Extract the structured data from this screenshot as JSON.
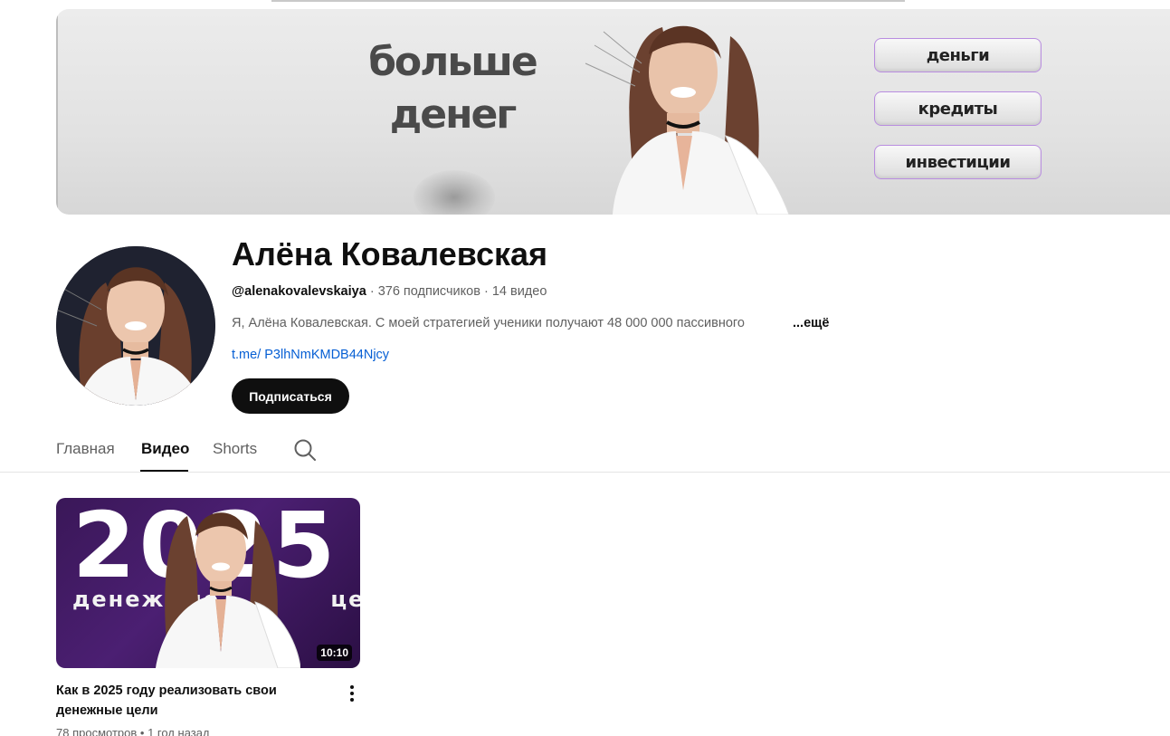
{
  "banner": {
    "headline_line1": "больше",
    "headline_line2": "денег",
    "pills": [
      "деньги",
      "кредиты",
      "инвестиции"
    ]
  },
  "channel": {
    "name": "Алёна Ковалевская",
    "handle": "@alenakovalevskaiya",
    "subscribers": "376 подписчиков",
    "video_count": "14 видео",
    "separator": "·",
    "description": "Я, Алёна Ковалевская. С моей стратегией ученики получают 48 000 000 пассивного",
    "more_label": "...ещё",
    "link": "t.me/ P3lhNmKMDB44Njcy",
    "subscribe_label": "Подписаться"
  },
  "tabs": {
    "items": [
      "Главная",
      "Видео",
      "Shorts"
    ],
    "active": "Видео"
  },
  "video": {
    "thumb_year": "2025",
    "thumb_caption": "денежные цели",
    "duration": "10:10",
    "title": "Как в 2025 году реализовать свои денежные цели",
    "views": "78 просмотров",
    "age": "1 год назад",
    "meta_separator": "•"
  },
  "colors": {
    "accent_link": "#065fd4",
    "pill_border": "#b98de0",
    "thumb_purple": "#4b1f72",
    "subscribe_bg": "#0f0f0f"
  },
  "icons": {
    "search": "search-icon",
    "more": "more-vert-icon"
  }
}
